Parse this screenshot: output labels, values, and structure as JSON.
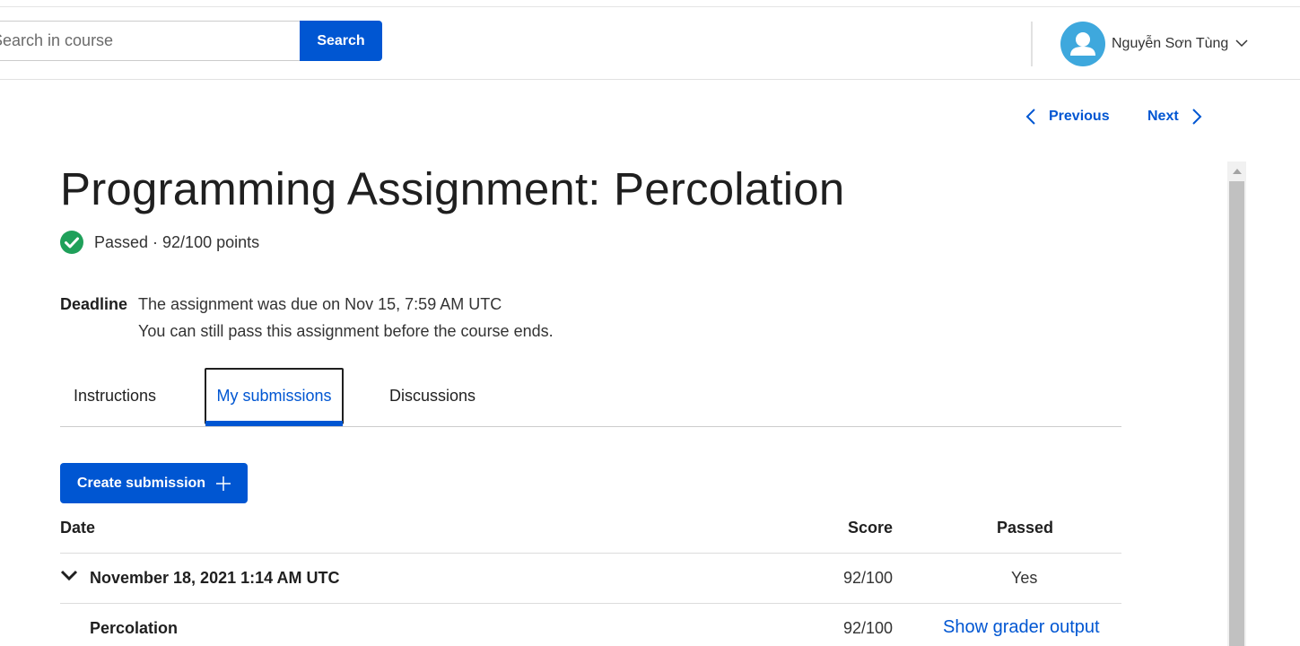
{
  "header": {
    "search_placeholder": "Search in course",
    "search_button": "Search",
    "user_name": "Nguyễn Sơn Tùng"
  },
  "nav": {
    "previous": "Previous",
    "next": "Next"
  },
  "assignment": {
    "title": "Programming Assignment: Percolation",
    "status": "Passed · 92/100 points",
    "deadline_label": "Deadline",
    "deadline_line1": "The assignment was due on Nov 15, 7:59 AM UTC",
    "deadline_line2": "You can still pass this assignment before the course ends."
  },
  "tabs": [
    {
      "label": "Instructions",
      "active": false
    },
    {
      "label": "My submissions",
      "active": true
    },
    {
      "label": "Discussions",
      "active": false
    }
  ],
  "create_submission": "Create submission",
  "table": {
    "columns": [
      "Date",
      "Score",
      "Passed"
    ],
    "submission": {
      "date": "November 18, 2021 1:14 AM UTC",
      "score": "92/100",
      "passed": "Yes",
      "parts": [
        {
          "name": "Percolation",
          "score": "92/100",
          "action": "Show grader output"
        }
      ]
    }
  },
  "colors": {
    "accent": "#0056d2",
    "success": "#1fa05a",
    "avatar": "#3ea8dd"
  }
}
